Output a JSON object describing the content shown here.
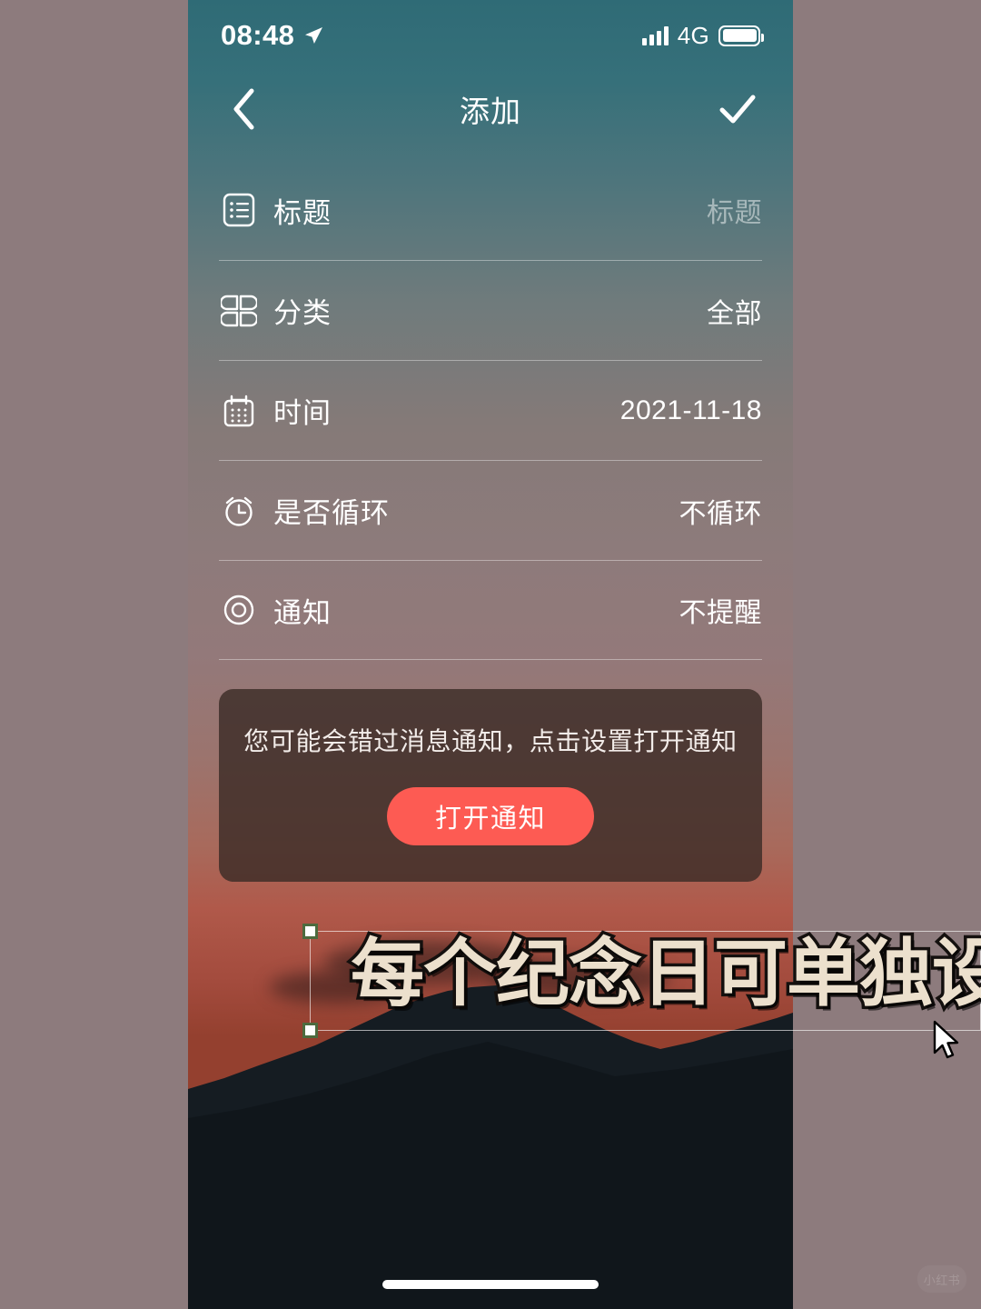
{
  "canvas": {
    "background_color": "#8d7b7d",
    "watermark_text": "小红书"
  },
  "phone": {
    "status_bar": {
      "time": "08:48",
      "location_icon": "location-arrow-icon",
      "signal_icon": "signal-bars-icon",
      "network": "4G",
      "battery_icon": "battery-full-icon"
    },
    "nav_bar": {
      "back_icon": "chevron-left-icon",
      "title": "添加",
      "confirm_icon": "checkmark-icon"
    },
    "form": {
      "rows": [
        {
          "icon": "list-note-icon",
          "label": "标题",
          "value": "标题",
          "is_placeholder": true
        },
        {
          "icon": "grid-clover-icon",
          "label": "分类",
          "value": "全部",
          "is_placeholder": false
        },
        {
          "icon": "calendar-icon",
          "label": "时间",
          "value": "2021-11-18",
          "is_placeholder": false
        },
        {
          "icon": "alarm-clock-icon",
          "label": "是否循环",
          "value": "不循环",
          "is_placeholder": false
        },
        {
          "icon": "circle-dot-icon",
          "label": "通知",
          "value": "不提醒",
          "is_placeholder": false
        }
      ]
    },
    "notification_card": {
      "message": "您可能会错过消息通知，点击设置打开通知",
      "button_label": "打开通知",
      "button_color": "#fd5b53",
      "card_color": "#3a2a26"
    },
    "home_indicator": "home-indicator"
  },
  "editor_overlay": {
    "caption_text": "每个纪念日可单独设置",
    "caption_fill_color": "#ece0cd",
    "caption_stroke_color": "#14100e",
    "selection_handle_color": "#4c6b3f",
    "cursor_icon": "arrow-cursor-icon"
  }
}
